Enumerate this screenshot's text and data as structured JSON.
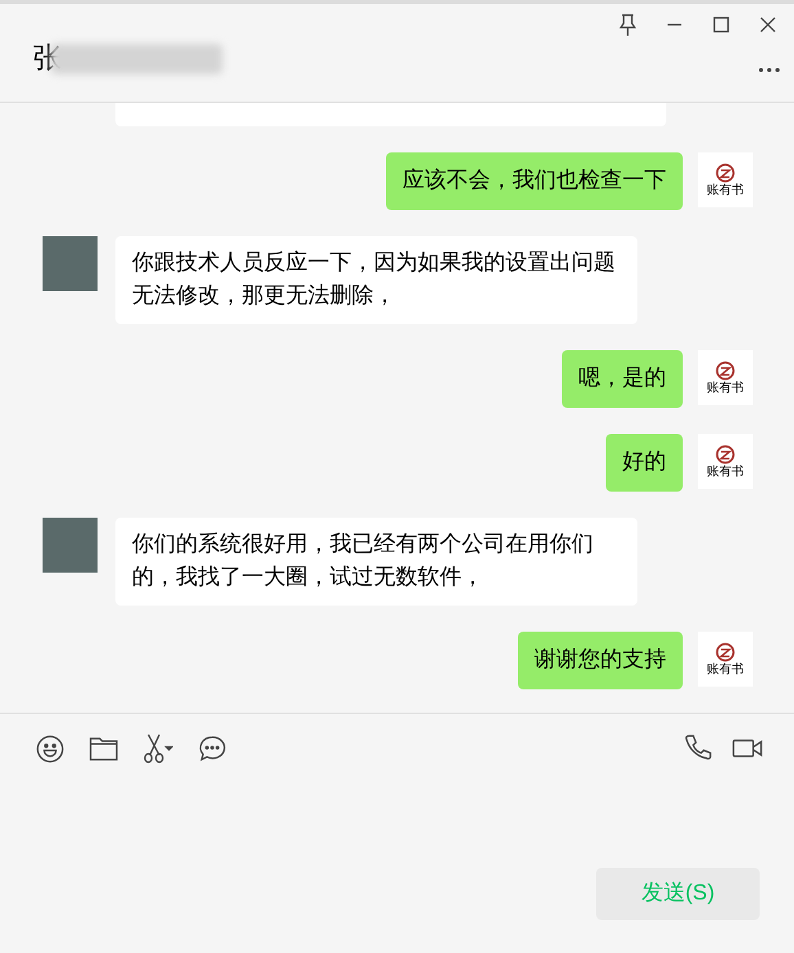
{
  "window": {
    "title": "张"
  },
  "messages": [
    {
      "kind": "received",
      "partial": true
    },
    {
      "kind": "sent",
      "text": "应该不会，我们也检查一下",
      "logo_text": "账有书"
    },
    {
      "kind": "received",
      "text": "你跟技术人员反应一下，因为如果我的设置出问题无法修改，那更无法删除，"
    },
    {
      "kind": "sent",
      "text": "嗯，是的",
      "logo_text": "账有书"
    },
    {
      "kind": "sent",
      "text": "好的",
      "logo_text": "账有书"
    },
    {
      "kind": "received",
      "text": "你们的系统很好用，我已经有两个公司在用你们的，我找了一大圈，试过无数软件，"
    },
    {
      "kind": "sent",
      "text": "谢谢您的支持",
      "logo_text": "账有书"
    }
  ],
  "send_button": {
    "label": "发送(S)"
  }
}
